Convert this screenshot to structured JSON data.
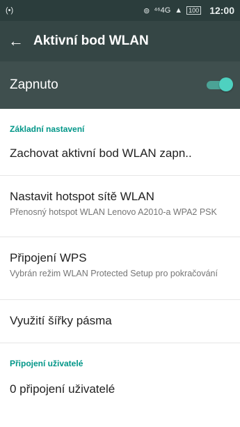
{
  "statusbar": {
    "left_icon": "(•)",
    "hotspot_icon": "⊚",
    "network": "⁴⁶4G",
    "signal_icon": "▲",
    "battery": "100",
    "time": "12:00"
  },
  "appbar": {
    "back_glyph": "←",
    "title": "Aktivní bod WLAN"
  },
  "toggle_row": {
    "label": "Zapnuto",
    "on": true
  },
  "sections": {
    "basic_header": "Základní nastavení",
    "users_header": "Připojení uživatelé"
  },
  "items": {
    "keep": {
      "title": "Zachovat aktivní bod WLAN zapn.."
    },
    "hotspot": {
      "title": "Nastavit hotspot sítě WLAN",
      "subtitle": "Přenosný hotspot WLAN Lenovo A2010-a WPA2 PSK"
    },
    "wps": {
      "title": "Připojení WPS",
      "subtitle": "Vybrán režim WLAN Protected Setup pro pokračování"
    },
    "bandwidth": {
      "title": "Využití šířky pásma"
    },
    "connected": {
      "title": "0 připojení uživatelé"
    }
  },
  "colors": {
    "statusbar_bg": "#2b3d3c",
    "appbar_bg": "#354645",
    "toggle_row_bg": "#3f4f4e",
    "accent": "#009688",
    "toggle_on": "#4ed1c0"
  }
}
